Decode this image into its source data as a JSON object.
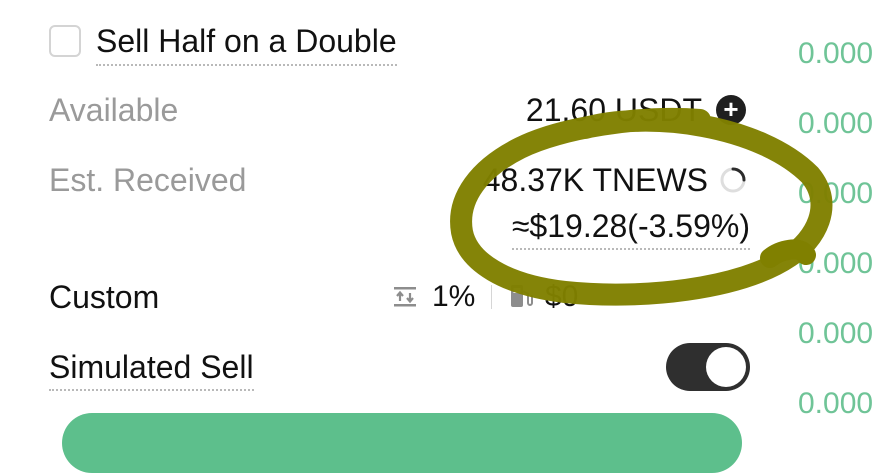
{
  "sell_half": {
    "label": "Sell Half on a Double",
    "checked": false
  },
  "available": {
    "label": "Available",
    "value": "21.60 USDT",
    "action_icon": "plus-circle-icon"
  },
  "est_received": {
    "label": "Est. Received",
    "value": "48.37K TNEWS",
    "approx": "≈$19.28(-3.59%)",
    "status_icon": "loading-spinner-icon"
  },
  "custom": {
    "label": "Custom",
    "slippage_icon": "slippage-icon",
    "slippage": "1%",
    "gas_icon": "gas-pump-icon",
    "gas": "$0"
  },
  "simulated_sell": {
    "label": "Simulated Sell",
    "enabled": true
  },
  "order_book": {
    "values": [
      "0.000",
      "0.000",
      "0.000",
      "0.000",
      "0.000",
      "0.000"
    ]
  },
  "colors": {
    "positive": "#6fc497",
    "button": "#5dbf8c",
    "annotation": "#808000",
    "toggle_on": "#2f2f2f"
  }
}
